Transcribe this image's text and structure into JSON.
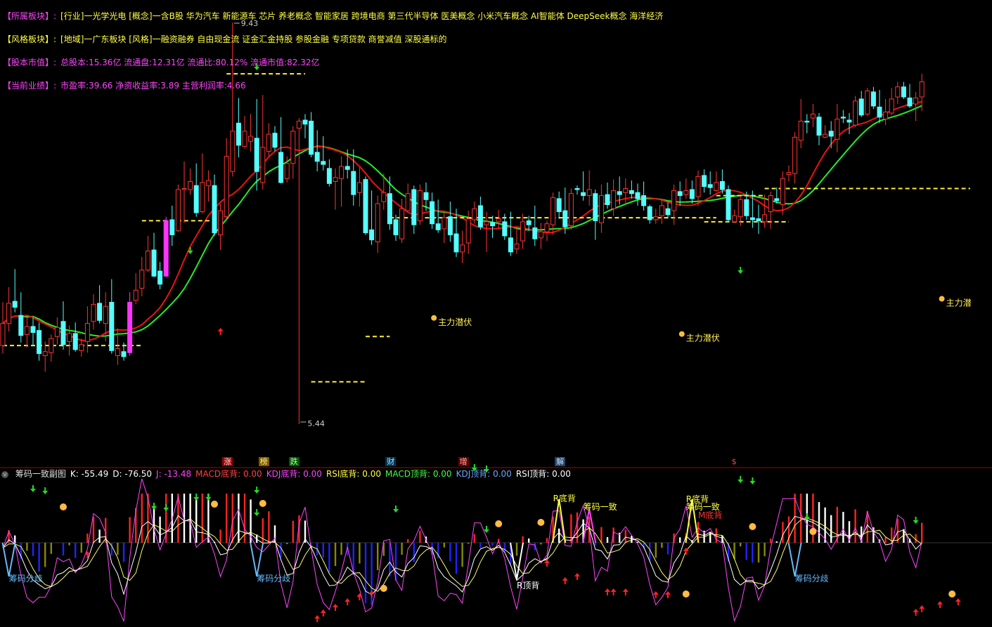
{
  "info_rows": [
    {
      "label": "【所属板块】:",
      "text": "[行业]一光学光电 [概念]一含B股 华为汽车 新能源车 芯片 养老概念 智能家居 跨境电商 第三代半导体 医美概念 小米汽车概念 AI智能体 DeepSeek概念 海洋经济",
      "label_color": "#ff44ff",
      "text_color": "#ffff44"
    },
    {
      "label": "【风格板块】:",
      "text": "[地域]一广东板块 [风格]一融资融券 自由现金流 证金汇金持股 参股金融 专项贷款 商誉减值 深股通标的",
      "label_color": "#ffff44",
      "text_color": "#ffff44"
    },
    {
      "label": "【股本市值】:",
      "text": "总股本:15.36亿 流通盘:12.31亿 流通比:80.12% 流通市值:82.32亿",
      "label_color": "#ff44ff",
      "text_color": "#ff44ff"
    },
    {
      "label": "【当前业绩】:",
      "text": "市盈率:39.66 净资收益率:3.89 主营利润率:4.66",
      "label_color": "#ff44ff",
      "text_color": "#ff44ff"
    }
  ],
  "event_markers": [
    {
      "text": "涨",
      "x_index": 37,
      "bg": "#990000",
      "color": "#ffdddd"
    },
    {
      "text": "榜",
      "x_index": 43,
      "bg": "#7a5a00",
      "color": "#ffee88"
    },
    {
      "text": "跌",
      "x_index": 48,
      "bg": "#005500",
      "color": "#aaffaa"
    },
    {
      "text": "财",
      "x_index": 64,
      "bg": "#003355",
      "color": "#aaddff"
    },
    {
      "text": "增",
      "x_index": 76,
      "bg": "#660000",
      "color": "#ffaaaa"
    },
    {
      "text": "解",
      "x_index": 92,
      "bg": "#224466",
      "color": "#ccddff"
    },
    {
      "text": "$",
      "x_index": 121,
      "bg": "#000000",
      "color": "#ff4444"
    }
  ],
  "sub_header": {
    "collapse_icon": "circle-chevron-icon",
    "items": [
      {
        "text": "筹码一致副图",
        "color": "#dddddd"
      },
      {
        "text": "K: -55.49",
        "color": "#ffffff"
      },
      {
        "text": "D: -76.50",
        "color": "#ffffff"
      },
      {
        "text": "J: -13.48",
        "color": "#ff44ff"
      },
      {
        "text": "MACD底背: 0.00",
        "color": "#ff4444"
      },
      {
        "text": "KDJ底背: 0.00",
        "color": "#ff44ff"
      },
      {
        "text": "RSI底背: 0.00",
        "color": "#ffff44"
      },
      {
        "text": "MACD顶背: 0.00",
        "color": "#44ff44"
      },
      {
        "text": "KDJ顶背: 0.00",
        "color": "#66aaff"
      },
      {
        "text": "RSI顶背: 0.00",
        "color": "#ffffff"
      }
    ]
  },
  "chart_data": [
    {
      "type": "candlestick",
      "price_high_label": "9.43",
      "price_low_label": "5.44",
      "annotations": [
        {
          "text": "主力潜伏",
          "x_index": 72,
          "price": 6.46
        },
        {
          "text": "主力潜伏",
          "x_index": 113,
          "price": 6.3
        },
        {
          "text": "主力潜",
          "x_index": 156,
          "price": 6.65
        }
      ],
      "colors": {
        "up": "#ff3333",
        "down": "#55ffff",
        "limit_up": "#ff33ff",
        "limit_down": "#33ff33",
        "ma_short": "#ee1111",
        "ma_long": "#22ee22",
        "level_line": "#ffee33",
        "arrow_up": "#ff2222",
        "arrow_down": "#22dd22"
      },
      "candles": [
        {
          "o": 6.22,
          "h": 6.65,
          "l": 6.14,
          "c": 6.44
        },
        {
          "o": 6.44,
          "h": 6.8,
          "l": 6.36,
          "c": 6.64
        },
        {
          "o": 6.66,
          "h": 6.98,
          "l": 6.55,
          "c": 6.6
        },
        {
          "o": 6.52,
          "h": 6.75,
          "l": 6.25,
          "c": 6.32
        },
        {
          "o": 6.33,
          "h": 6.5,
          "l": 6.2,
          "c": 6.41
        },
        {
          "o": 6.41,
          "h": 6.5,
          "l": 6.22,
          "c": 6.35
        },
        {
          "o": 6.37,
          "h": 6.45,
          "l": 6.07,
          "c": 6.14
        },
        {
          "o": 6.12,
          "h": 6.26,
          "l": 5.96,
          "c": 6.16
        },
        {
          "o": 6.15,
          "h": 6.33,
          "l": 6.06,
          "c": 6.29
        },
        {
          "o": 6.31,
          "h": 6.5,
          "l": 6.23,
          "c": 6.4
        },
        {
          "o": 6.46,
          "h": 6.66,
          "l": 6.18,
          "c": 6.23
        },
        {
          "o": 6.26,
          "h": 6.42,
          "l": 6.12,
          "c": 6.34
        },
        {
          "o": 6.34,
          "h": 6.45,
          "l": 6.16,
          "c": 6.18
        },
        {
          "o": 6.17,
          "h": 6.29,
          "l": 6.11,
          "c": 6.23
        },
        {
          "o": 6.26,
          "h": 6.61,
          "l": 6.15,
          "c": 6.44
        },
        {
          "o": 6.46,
          "h": 6.73,
          "l": 6.38,
          "c": 6.63
        },
        {
          "o": 6.64,
          "h": 6.82,
          "l": 6.44,
          "c": 6.47
        },
        {
          "o": 6.44,
          "h": 6.75,
          "l": 6.26,
          "c": 6.61
        },
        {
          "o": 6.65,
          "h": 6.88,
          "l": 6.14,
          "c": 6.17
        },
        {
          "o": 6.12,
          "h": 6.39,
          "l": 6.03,
          "c": 6.19
        },
        {
          "o": 6.16,
          "h": 6.25,
          "l": 6.07,
          "c": 6.11
        },
        {
          "o": 6.15,
          "h": 6.75,
          "l": 6.12,
          "c": 6.65
        },
        {
          "o": 6.67,
          "h": 6.94,
          "l": 6.63,
          "c": 6.77
        },
        {
          "o": 6.79,
          "h": 7.1,
          "l": 6.71,
          "c": 6.97
        },
        {
          "o": 6.97,
          "h": 7.31,
          "l": 6.95,
          "c": 7.16
        },
        {
          "o": 7.17,
          "h": 7.34,
          "l": 6.9,
          "c": 6.91
        },
        {
          "o": 6.96,
          "h": 7.05,
          "l": 6.78,
          "c": 6.83
        },
        {
          "o": 6.91,
          "h": 7.5,
          "l": 6.9,
          "c": 7.46
        },
        {
          "o": 7.47,
          "h": 7.61,
          "l": 7.21,
          "c": 7.32
        },
        {
          "o": 7.36,
          "h": 7.82,
          "l": 7.35,
          "c": 7.77
        },
        {
          "o": 7.77,
          "h": 8.05,
          "l": 7.44,
          "c": 7.78
        },
        {
          "o": 7.77,
          "h": 7.98,
          "l": 7.72,
          "c": 7.85
        },
        {
          "o": 7.81,
          "h": 8.03,
          "l": 7.5,
          "c": 7.54
        },
        {
          "o": 7.55,
          "h": 8.13,
          "l": 7.53,
          "c": 7.84
        },
        {
          "o": 7.81,
          "h": 7.96,
          "l": 7.65,
          "c": 7.86
        },
        {
          "o": 7.81,
          "h": 7.92,
          "l": 7.31,
          "c": 7.34
        },
        {
          "o": 7.32,
          "h": 7.63,
          "l": 7.17,
          "c": 7.56
        },
        {
          "o": 7.5,
          "h": 8.28,
          "l": 7.48,
          "c": 8.1
        },
        {
          "o": 7.95,
          "h": 8.69,
          "l": 7.9,
          "c": 8.35
        },
        {
          "o": 8.43,
          "h": 8.68,
          "l": 8.09,
          "c": 8.21
        },
        {
          "o": 8.2,
          "h": 8.5,
          "l": 8.18,
          "c": 8.35
        },
        {
          "o": 8.25,
          "h": 8.52,
          "l": 8.15,
          "c": 8.3
        },
        {
          "o": 8.28,
          "h": 8.67,
          "l": 7.76,
          "c": 7.95
        },
        {
          "o": 7.84,
          "h": 8.71,
          "l": 7.77,
          "c": 8.19
        },
        {
          "o": 8.15,
          "h": 8.43,
          "l": 8.1,
          "c": 8.32
        },
        {
          "o": 8.33,
          "h": 8.4,
          "l": 8.15,
          "c": 8.19
        },
        {
          "o": 8.14,
          "h": 8.49,
          "l": 7.83,
          "c": 7.84
        },
        {
          "o": 7.88,
          "h": 8.1,
          "l": 7.84,
          "c": 8.03
        },
        {
          "o": 8.03,
          "h": 8.4,
          "l": 7.88,
          "c": 8.35
        },
        {
          "o": 8.38,
          "h": 8.48,
          "l": 8.34,
          "c": 8.45
        },
        {
          "o": 8.46,
          "h": 8.52,
          "l": 8.28,
          "c": 8.42
        },
        {
          "o": 8.45,
          "h": 8.54,
          "l": 8.09,
          "c": 8.12
        },
        {
          "o": 8.14,
          "h": 8.36,
          "l": 7.95,
          "c": 8.05
        },
        {
          "o": 8.05,
          "h": 8.3,
          "l": 7.96,
          "c": 8.02
        },
        {
          "o": 7.98,
          "h": 8.07,
          "l": 7.8,
          "c": 7.83
        },
        {
          "o": 7.85,
          "h": 7.98,
          "l": 7.57,
          "c": 7.89
        },
        {
          "o": 7.88,
          "h": 8.1,
          "l": 7.6,
          "c": 8.0
        },
        {
          "o": 8.0,
          "h": 8.17,
          "l": 7.88,
          "c": 7.97
        },
        {
          "o": 7.95,
          "h": 8.17,
          "l": 7.61,
          "c": 7.72
        },
        {
          "o": 7.74,
          "h": 7.99,
          "l": 7.6,
          "c": 7.84
        },
        {
          "o": 7.87,
          "h": 7.9,
          "l": 7.32,
          "c": 7.34
        },
        {
          "o": 7.37,
          "h": 7.76,
          "l": 7.22,
          "c": 7.27
        },
        {
          "o": 7.25,
          "h": 7.71,
          "l": 7.14,
          "c": 7.63
        },
        {
          "o": 7.65,
          "h": 7.93,
          "l": 7.57,
          "c": 7.74
        },
        {
          "o": 7.73,
          "h": 7.9,
          "l": 7.37,
          "c": 7.43
        },
        {
          "o": 7.47,
          "h": 7.52,
          "l": 7.26,
          "c": 7.32
        },
        {
          "o": 7.28,
          "h": 7.68,
          "l": 7.24,
          "c": 7.58
        },
        {
          "o": 7.56,
          "h": 7.83,
          "l": 7.56,
          "c": 7.73
        },
        {
          "o": 7.77,
          "h": 7.81,
          "l": 7.33,
          "c": 7.42
        },
        {
          "o": 7.46,
          "h": 7.82,
          "l": 7.42,
          "c": 7.76
        },
        {
          "o": 7.74,
          "h": 7.84,
          "l": 7.56,
          "c": 7.67
        },
        {
          "o": 7.65,
          "h": 7.74,
          "l": 7.38,
          "c": 7.43
        },
        {
          "o": 7.43,
          "h": 7.67,
          "l": 7.34,
          "c": 7.37
        },
        {
          "o": 7.38,
          "h": 7.54,
          "l": 7.24,
          "c": 7.49
        },
        {
          "o": 7.5,
          "h": 7.65,
          "l": 7.25,
          "c": 7.32
        },
        {
          "o": 7.33,
          "h": 7.58,
          "l": 7.1,
          "c": 7.15
        },
        {
          "o": 7.15,
          "h": 7.36,
          "l": 7.04,
          "c": 7.22
        },
        {
          "o": 7.24,
          "h": 7.56,
          "l": 7.13,
          "c": 7.48
        },
        {
          "o": 7.47,
          "h": 7.65,
          "l": 7.43,
          "c": 7.58
        },
        {
          "o": 7.61,
          "h": 7.7,
          "l": 7.37,
          "c": 7.4
        },
        {
          "o": 7.42,
          "h": 7.55,
          "l": 7.15,
          "c": 7.45
        },
        {
          "o": 7.44,
          "h": 7.51,
          "l": 7.29,
          "c": 7.41
        },
        {
          "o": 7.45,
          "h": 7.57,
          "l": 7.38,
          "c": 7.48
        },
        {
          "o": 7.45,
          "h": 7.53,
          "l": 7.27,
          "c": 7.31
        },
        {
          "o": 7.29,
          "h": 7.55,
          "l": 7.11,
          "c": 7.15
        },
        {
          "o": 7.18,
          "h": 7.4,
          "l": 7.13,
          "c": 7.23
        },
        {
          "o": 7.26,
          "h": 7.53,
          "l": 7.18,
          "c": 7.45
        },
        {
          "o": 7.46,
          "h": 7.51,
          "l": 7.36,
          "c": 7.42
        },
        {
          "o": 7.39,
          "h": 7.61,
          "l": 7.21,
          "c": 7.28
        },
        {
          "o": 7.29,
          "h": 7.44,
          "l": 7.18,
          "c": 7.35
        },
        {
          "o": 7.35,
          "h": 7.46,
          "l": 7.26,
          "c": 7.43
        },
        {
          "o": 7.42,
          "h": 7.74,
          "l": 7.32,
          "c": 7.69
        },
        {
          "o": 7.68,
          "h": 7.75,
          "l": 7.48,
          "c": 7.55
        },
        {
          "o": 7.56,
          "h": 7.79,
          "l": 7.33,
          "c": 7.4
        },
        {
          "o": 7.41,
          "h": 7.78,
          "l": 7.37,
          "c": 7.73
        },
        {
          "o": 7.78,
          "h": 7.81,
          "l": 7.72,
          "c": 7.77
        },
        {
          "o": 7.74,
          "h": 7.95,
          "l": 7.66,
          "c": 7.71
        },
        {
          "o": 7.71,
          "h": 7.96,
          "l": 7.61,
          "c": 7.77
        },
        {
          "o": 7.73,
          "h": 7.77,
          "l": 7.27,
          "c": 7.46
        },
        {
          "o": 7.44,
          "h": 7.82,
          "l": 7.34,
          "c": 7.71
        },
        {
          "o": 7.72,
          "h": 7.84,
          "l": 7.58,
          "c": 7.62
        },
        {
          "o": 7.58,
          "h": 7.87,
          "l": 7.51,
          "c": 7.76
        },
        {
          "o": 7.75,
          "h": 7.9,
          "l": 7.62,
          "c": 7.72
        },
        {
          "o": 7.74,
          "h": 7.88,
          "l": 7.62,
          "c": 7.78
        },
        {
          "o": 7.76,
          "h": 7.86,
          "l": 7.68,
          "c": 7.73
        },
        {
          "o": 7.74,
          "h": 7.83,
          "l": 7.61,
          "c": 7.68
        },
        {
          "o": 7.71,
          "h": 7.85,
          "l": 7.56,
          "c": 7.61
        },
        {
          "o": 7.6,
          "h": 7.62,
          "l": 7.43,
          "c": 7.47
        },
        {
          "o": 7.47,
          "h": 7.58,
          "l": 7.43,
          "c": 7.5
        },
        {
          "o": 7.51,
          "h": 7.68,
          "l": 7.43,
          "c": 7.61
        },
        {
          "o": 7.58,
          "h": 7.64,
          "l": 7.48,
          "c": 7.52
        },
        {
          "o": 7.56,
          "h": 7.82,
          "l": 7.42,
          "c": 7.76
        },
        {
          "o": 7.75,
          "h": 7.85,
          "l": 7.61,
          "c": 7.71
        },
        {
          "o": 7.72,
          "h": 7.88,
          "l": 7.68,
          "c": 7.76
        },
        {
          "o": 7.77,
          "h": 7.86,
          "l": 7.63,
          "c": 7.68
        },
        {
          "o": 7.7,
          "h": 7.96,
          "l": 7.61,
          "c": 7.9
        },
        {
          "o": 7.91,
          "h": 7.97,
          "l": 7.74,
          "c": 7.8
        },
        {
          "o": 7.82,
          "h": 7.95,
          "l": 7.72,
          "c": 7.79
        },
        {
          "o": 7.76,
          "h": 7.95,
          "l": 7.75,
          "c": 7.84
        },
        {
          "o": 7.85,
          "h": 7.97,
          "l": 7.73,
          "c": 7.77
        },
        {
          "o": 7.77,
          "h": 7.81,
          "l": 7.45,
          "c": 7.47
        },
        {
          "o": 7.45,
          "h": 7.57,
          "l": 7.44,
          "c": 7.51
        },
        {
          "o": 7.5,
          "h": 7.71,
          "l": 7.41,
          "c": 7.67
        },
        {
          "o": 7.67,
          "h": 7.75,
          "l": 7.47,
          "c": 7.51
        },
        {
          "o": 7.49,
          "h": 7.76,
          "l": 7.39,
          "c": 7.47
        },
        {
          "o": 7.48,
          "h": 7.62,
          "l": 7.33,
          "c": 7.46
        },
        {
          "o": 7.45,
          "h": 7.72,
          "l": 7.39,
          "c": 7.52
        },
        {
          "o": 7.55,
          "h": 7.75,
          "l": 7.38,
          "c": 7.71
        },
        {
          "o": 7.68,
          "h": 7.79,
          "l": 7.63,
          "c": 7.66
        },
        {
          "o": 7.62,
          "h": 7.95,
          "l": 7.52,
          "c": 7.88
        },
        {
          "o": 7.92,
          "h": 8.01,
          "l": 7.85,
          "c": 7.94
        },
        {
          "o": 7.93,
          "h": 8.34,
          "l": 7.83,
          "c": 8.29
        },
        {
          "o": 8.26,
          "h": 8.67,
          "l": 8.18,
          "c": 8.45
        },
        {
          "o": 8.45,
          "h": 8.52,
          "l": 8.33,
          "c": 8.44
        },
        {
          "o": 8.48,
          "h": 8.62,
          "l": 8.39,
          "c": 8.52
        },
        {
          "o": 8.49,
          "h": 8.53,
          "l": 8.21,
          "c": 8.31
        },
        {
          "o": 8.29,
          "h": 8.41,
          "l": 8.28,
          "c": 8.32
        },
        {
          "o": 8.35,
          "h": 8.45,
          "l": 8.18,
          "c": 8.3
        },
        {
          "o": 8.27,
          "h": 8.62,
          "l": 8.14,
          "c": 8.47
        },
        {
          "o": 8.49,
          "h": 8.56,
          "l": 8.43,
          "c": 8.48
        },
        {
          "o": 8.46,
          "h": 8.53,
          "l": 8.32,
          "c": 8.44
        },
        {
          "o": 8.41,
          "h": 8.7,
          "l": 8.39,
          "c": 8.65
        },
        {
          "o": 8.67,
          "h": 8.75,
          "l": 8.49,
          "c": 8.51
        },
        {
          "o": 8.52,
          "h": 8.78,
          "l": 8.5,
          "c": 8.75
        },
        {
          "o": 8.74,
          "h": 8.79,
          "l": 8.57,
          "c": 8.6
        },
        {
          "o": 8.59,
          "h": 8.76,
          "l": 8.43,
          "c": 8.49
        },
        {
          "o": 8.47,
          "h": 8.67,
          "l": 8.41,
          "c": 8.54
        },
        {
          "o": 8.53,
          "h": 8.78,
          "l": 8.51,
          "c": 8.67
        },
        {
          "o": 8.69,
          "h": 8.84,
          "l": 8.62,
          "c": 8.79
        },
        {
          "o": 8.79,
          "h": 8.84,
          "l": 8.67,
          "c": 8.69
        },
        {
          "o": 8.68,
          "h": 8.82,
          "l": 8.58,
          "c": 8.6
        },
        {
          "o": 8.62,
          "h": 8.74,
          "l": 8.45,
          "c": 8.68
        },
        {
          "o": 8.69,
          "h": 8.92,
          "l": 8.55,
          "c": 8.84
        }
      ]
    },
    {
      "type": "line",
      "series": [
        {
          "name": "K",
          "values": [
            -55.49
          ]
        },
        {
          "name": "D",
          "values": [
            -76.5
          ]
        },
        {
          "name": "J",
          "values": [
            -13.48
          ]
        }
      ],
      "labels": [
        {
          "text": "筹码分歧",
          "color": "#66bbff"
        },
        {
          "text": "筹码分歧",
          "color": "#66bbff"
        },
        {
          "text": "筹码分歧",
          "color": "#66bbff"
        },
        {
          "text": "R底背",
          "color": "#ffff44"
        },
        {
          "text": "筹码一致",
          "color": "#ffff44"
        },
        {
          "text": "R底背",
          "color": "#ffff44"
        },
        {
          "text": "筹码一致",
          "color": "#ffff44"
        },
        {
          "text": "M底背",
          "color": "#ff3333"
        },
        {
          "text": "R顶背",
          "color": "#ffffff"
        }
      ]
    }
  ]
}
